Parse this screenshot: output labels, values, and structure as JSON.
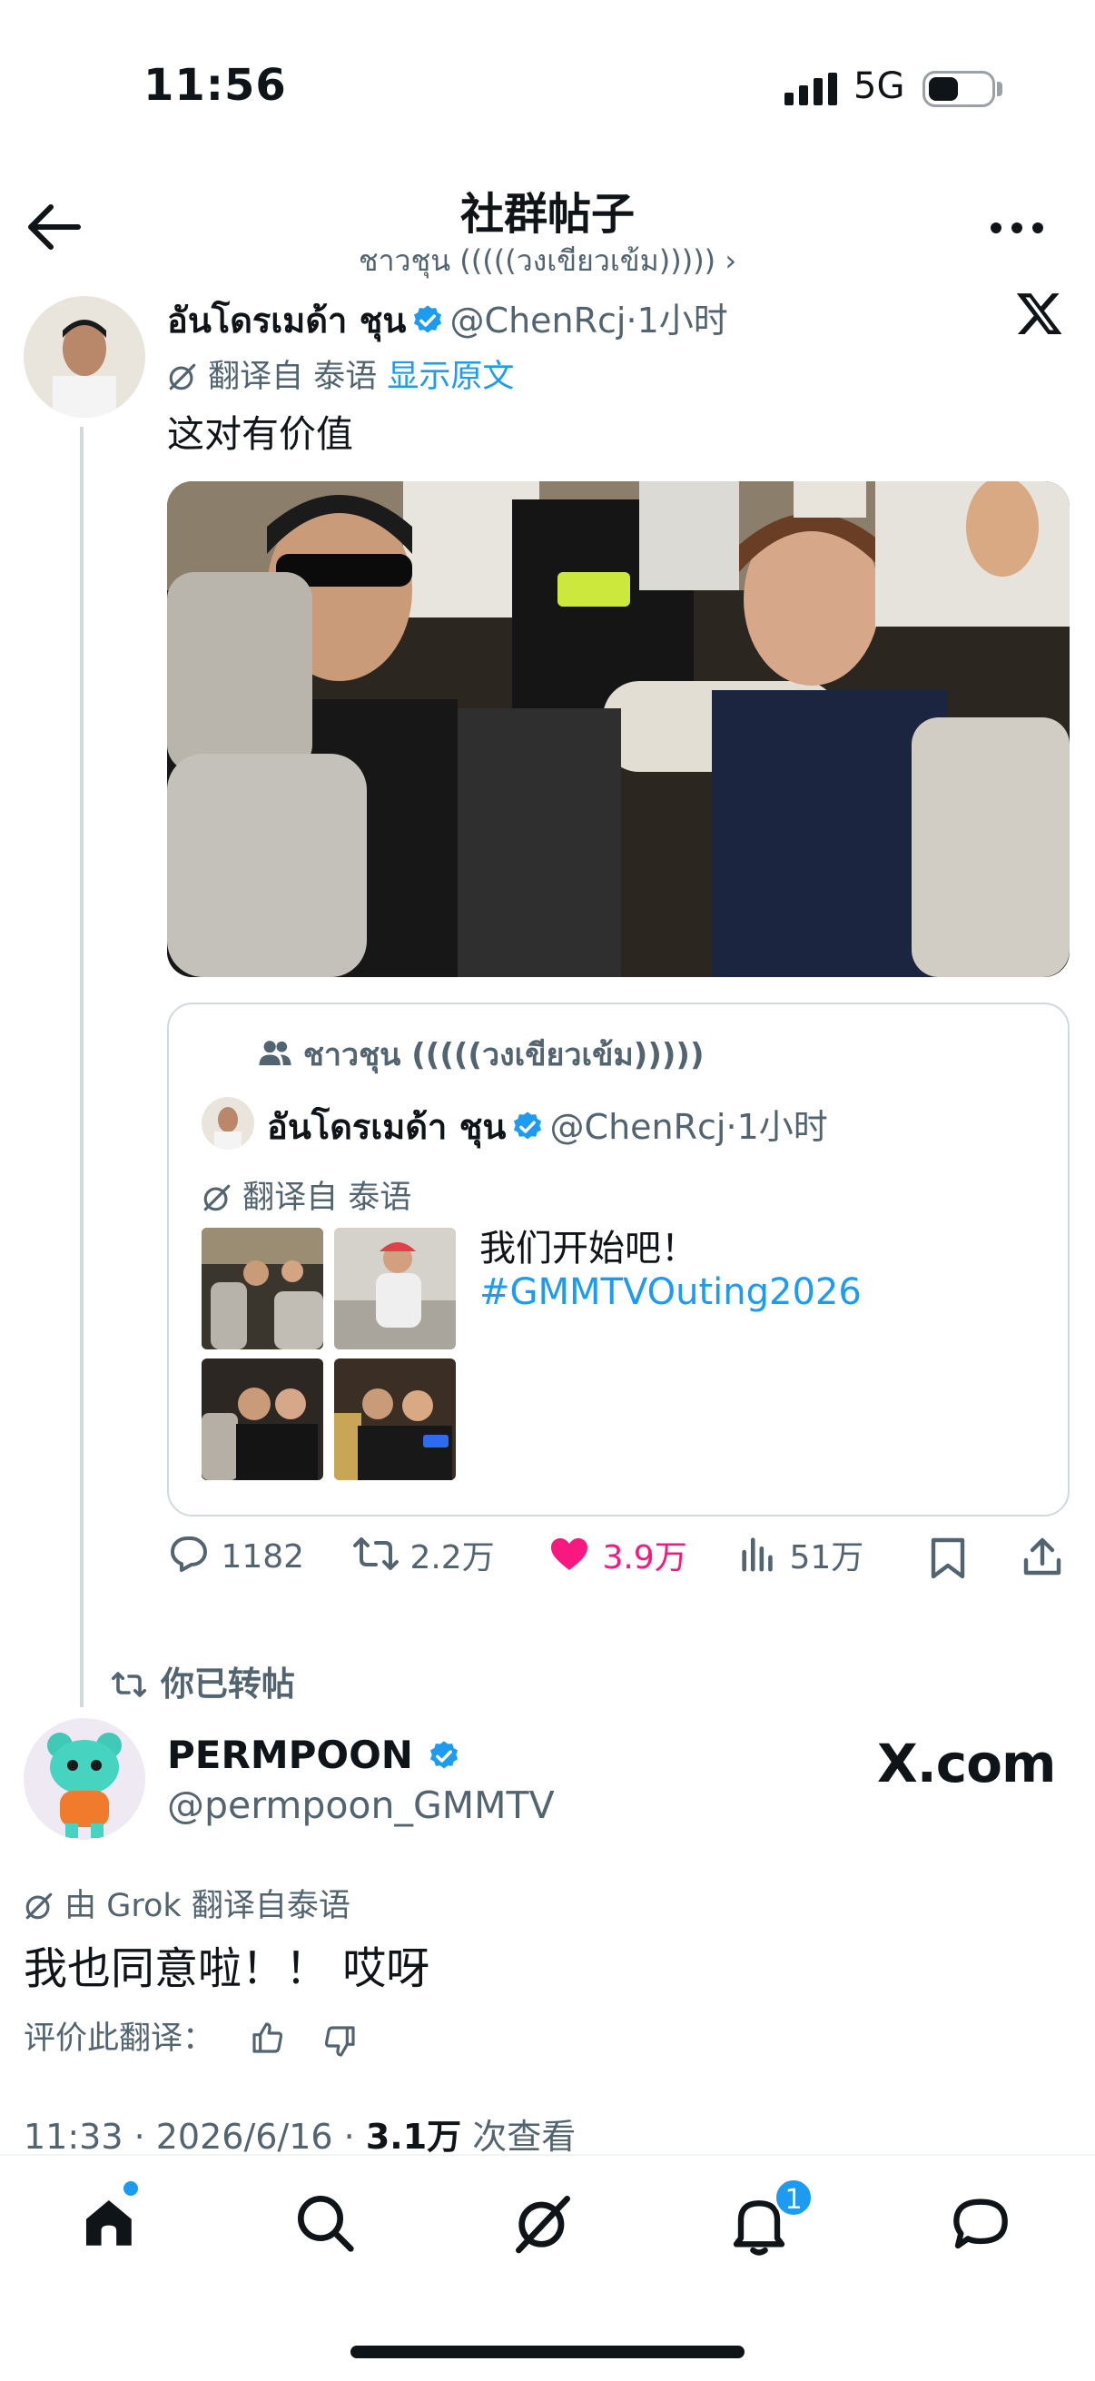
{
  "status": {
    "time": "11:56",
    "network": "5G"
  },
  "header": {
    "title": "社群帖子",
    "subtitle": "ชาวชุน (((((วงเขียวเข้ม))))) ›"
  },
  "tweet": {
    "author_name": "อันโดรเมด้า ชุน",
    "handle": "@ChenRcj",
    "time": "·1小时",
    "translated_from": "翻译自 泰语",
    "show_original": "显示原文",
    "text": "这对有价值",
    "quote": {
      "community": "ชาวชุน (((((วงเขียวเข้ม)))))",
      "author_name": "อันโดรเมด้า ชุน",
      "handle": "@ChenRcj",
      "time": "·1小时",
      "translated_from": "翻译自 泰语",
      "text": "我们开始吧！",
      "hashtag": "#GMMTVOuting2026"
    },
    "actions": {
      "replies": "1182",
      "reposts": "2.2万",
      "likes": "3.9万",
      "views": "51万"
    }
  },
  "repost_label": "你已转帖",
  "main_post": {
    "author_name": "PERMPOON",
    "handle": "@permpoon_GMMTV",
    "watermark": "X.com",
    "grok_line": "由 Grok 翻译自泰语",
    "text": "我也同意啦！！ 哎呀",
    "rate_label": "评价此翻译：",
    "timestamp": "11:33 · 2026/6/16 · ",
    "views_count": "3.1万",
    "views_label": " 次查看"
  },
  "tabbar": {
    "notifications_badge": "1"
  },
  "colors": {
    "accent": "#1d9bf0",
    "like": "#f91880",
    "text": "#0f1419",
    "muted": "#536471"
  }
}
